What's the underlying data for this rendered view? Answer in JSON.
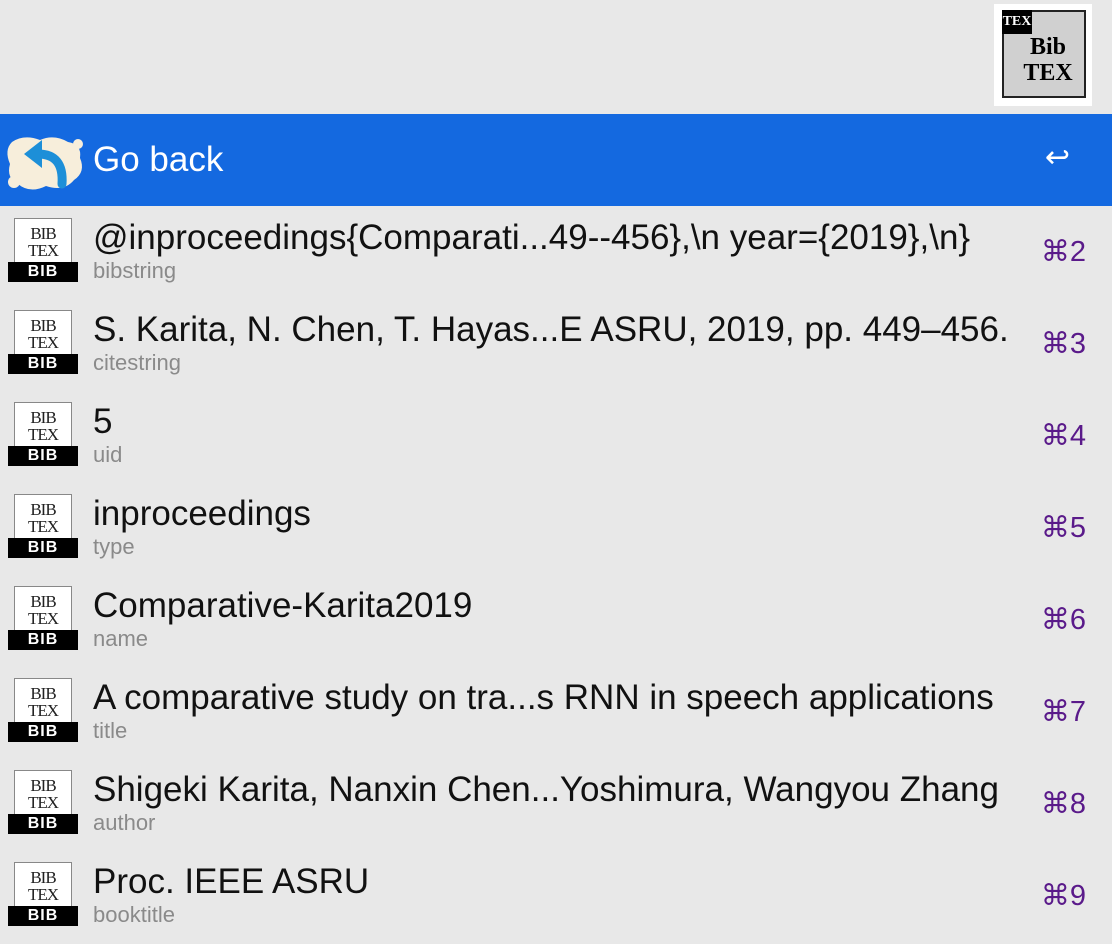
{
  "window": {
    "logo_badge": "TEX",
    "logo_text_line1": "Bib",
    "logo_text_line2": "TEX"
  },
  "selected_row": {
    "title": "Go back",
    "shortcut": "↩"
  },
  "icon_text": {
    "top1": "BIB",
    "top2": "TEX",
    "label": "BIB"
  },
  "rows": [
    {
      "title": "@inproceedings{Comparati...49--456},\\n  year={2019},\\n}",
      "subtitle": "bibstring",
      "shortcut": "⌘2"
    },
    {
      "title": "S. Karita, N. Chen, T. Hayas...E ASRU, 2019, pp. 449–456.",
      "subtitle": "citestring",
      "shortcut": "⌘3"
    },
    {
      "title": "5",
      "subtitle": "uid",
      "shortcut": "⌘4"
    },
    {
      "title": "inproceedings",
      "subtitle": "type",
      "shortcut": "⌘5"
    },
    {
      "title": "Comparative-Karita2019",
      "subtitle": "name",
      "shortcut": "⌘6"
    },
    {
      "title": "A comparative study on tra...s RNN in speech applications",
      "subtitle": "title",
      "shortcut": "⌘7"
    },
    {
      "title": "Shigeki Karita, Nanxin Chen...Yoshimura, Wangyou Zhang",
      "subtitle": "author",
      "shortcut": "⌘8"
    },
    {
      "title": "Proc. IEEE ASRU",
      "subtitle": "booktitle",
      "shortcut": "⌘9"
    }
  ]
}
